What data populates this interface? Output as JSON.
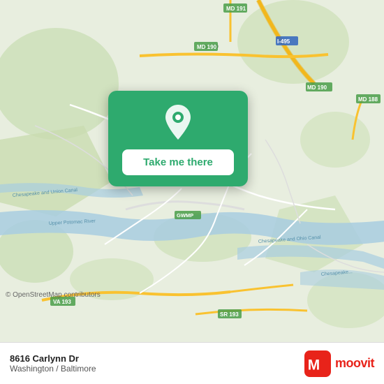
{
  "map": {
    "background_color": "#e8eee0",
    "osm_credit": "© OpenStreetMap contributors"
  },
  "card": {
    "button_label": "Take me there",
    "pin_icon": "location-pin-icon"
  },
  "bottom_bar": {
    "address": "8616 Carlynn Dr",
    "city": "Washington / Baltimore",
    "moovit_label": "moovit"
  }
}
